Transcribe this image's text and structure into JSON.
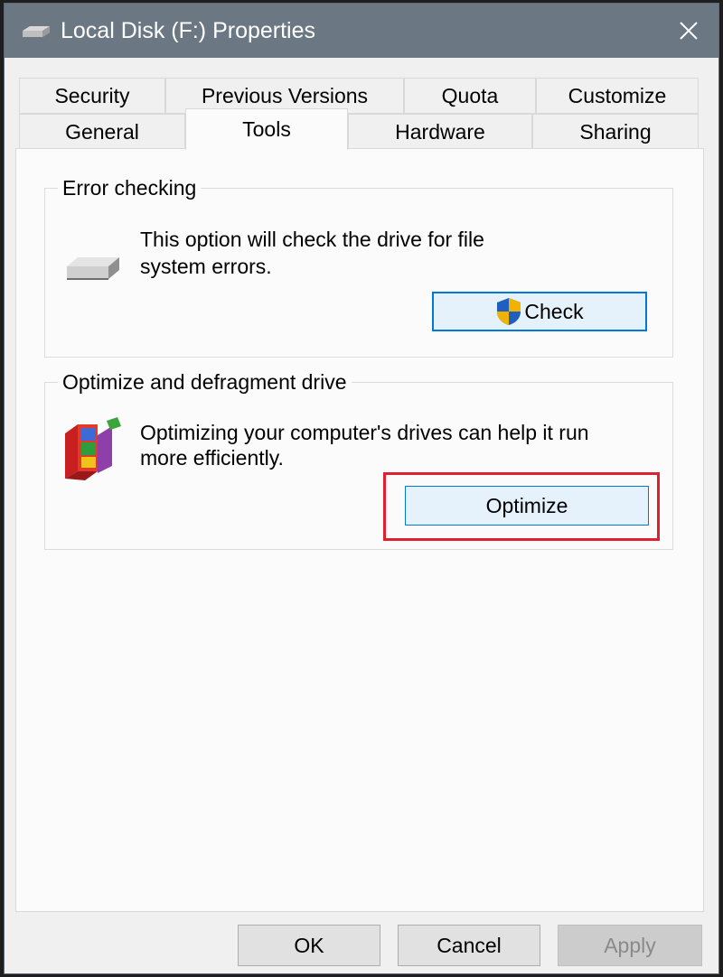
{
  "window": {
    "title": "Local Disk (F:) Properties",
    "close_glyph": "✕"
  },
  "tabs": {
    "back_row": [
      "Security",
      "Previous Versions",
      "Quota",
      "Customize"
    ],
    "front_row": [
      "General",
      "Tools",
      "Hardware",
      "Sharing"
    ],
    "active": "Tools"
  },
  "error_checking": {
    "title": "Error checking",
    "description_line1": "This option will check the drive for file",
    "description_line2": "system errors.",
    "button_label": "Check"
  },
  "optimize": {
    "title": "Optimize and defragment drive",
    "description_line1": "Optimizing your computer's drives can help it run",
    "description_line2": "more efficiently.",
    "button_label": "Optimize"
  },
  "footer": {
    "ok_label": "OK",
    "cancel_label": "Cancel",
    "apply_label": "Apply"
  },
  "colors": {
    "titlebar": "#6b7783",
    "focus_blue": "#0078d7",
    "highlight_red": "#e02030"
  }
}
